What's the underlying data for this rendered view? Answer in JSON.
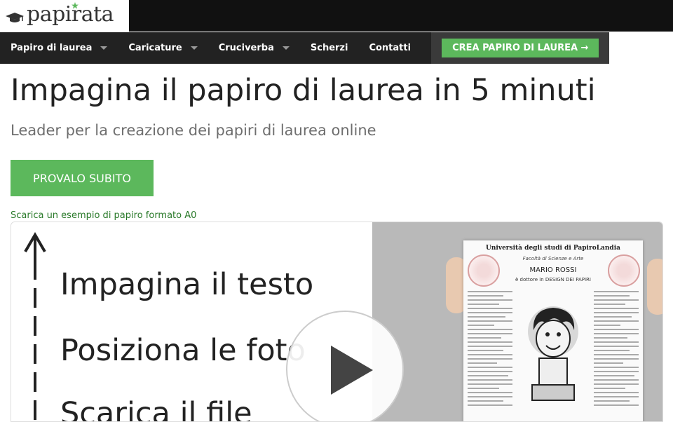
{
  "brand": {
    "logo_text_prefix": "papi",
    "logo_text_suffix": "rata"
  },
  "nav": {
    "items": [
      {
        "label": "Papiro di laurea",
        "has_dropdown": true
      },
      {
        "label": "Caricature",
        "has_dropdown": true
      },
      {
        "label": "Cruciverba",
        "has_dropdown": true
      },
      {
        "label": "Scherzi",
        "has_dropdown": false
      },
      {
        "label": "Contatti",
        "has_dropdown": false
      }
    ],
    "cta_label": "CREA PAPIRO DI LAUREA →"
  },
  "hero": {
    "title": "Impagina il papiro di laurea in 5 minuti",
    "subtitle": "Leader per la creazione dei papiri di laurea online",
    "button_label": "PROVALO SUBITO",
    "sample_link": "Scarica un esempio di papiro formato A0"
  },
  "video": {
    "steps": [
      "Impagina il testo",
      "Posiziona le foto",
      "Scarica il file"
    ],
    "poster": {
      "university": "Università degli studi di PapiroLandia",
      "faculty": "Facoltà di Scienze e Arte",
      "name": "MARIO ROSSI",
      "subtitle": "è dottore in DESIGN DEI PAPIRI"
    }
  },
  "colors": {
    "accent": "#5cb85c",
    "nav_bg": "#222222",
    "topbar_bg": "#111111"
  }
}
